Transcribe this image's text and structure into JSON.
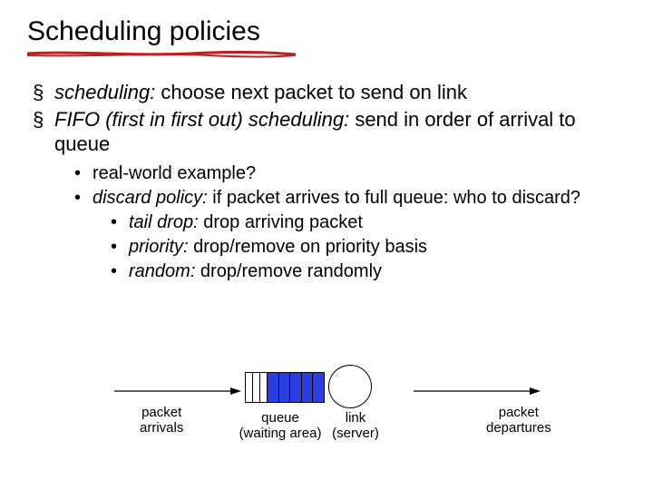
{
  "title": "Scheduling policies",
  "bullets": {
    "b1_italic": "scheduling:",
    "b1_rest": " choose next packet to send on link",
    "b2_italic": "FIFO (first in first out) scheduling:",
    "b2_rest": " send in order of arrival to queue",
    "sb1": "real-world example?",
    "sb2_italic": "discard policy:",
    "sb2_rest": " if packet arrives to full queue: who to discard?",
    "ssb1_italic": "tail drop:",
    "ssb1_rest": " drop arriving packet",
    "ssb2_italic": "priority:",
    "ssb2_rest": " drop/remove on priority basis",
    "ssb3_italic": "random:",
    "ssb3_rest": " drop/remove randomly"
  },
  "diagram": {
    "arrivals_l1": "packet",
    "arrivals_l2": "arrivals",
    "queue_l1": "queue",
    "queue_l2": "(waiting area)",
    "link_l1": "link",
    "link_l2": "(server)",
    "departures_l1": "packet",
    "departures_l2": "departures"
  },
  "colors": {
    "underline": "#c11f1f",
    "queue_fill": "#2b3fe0"
  }
}
